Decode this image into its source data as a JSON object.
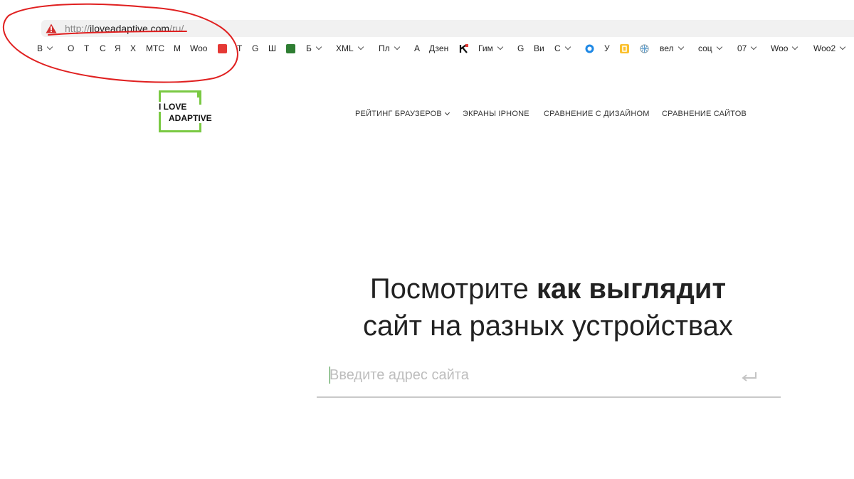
{
  "browser": {
    "url_protocol": "http://",
    "url_host": "iloveadaptive.com",
    "url_path": "/ru/",
    "security_icon": "warning-triangle-icon"
  },
  "bookmarks": [
    {
      "label": "В",
      "dropdown": true
    },
    {
      "label": "О"
    },
    {
      "label": "Т"
    },
    {
      "label": "С"
    },
    {
      "label": "Я"
    },
    {
      "label": "Х"
    },
    {
      "label": "МТС"
    },
    {
      "label": "М"
    },
    {
      "label": "Woo"
    },
    {
      "label": "",
      "icon": "red-square-favicon"
    },
    {
      "label": "Т"
    },
    {
      "label": "G"
    },
    {
      "label": "Ш"
    },
    {
      "label": "",
      "icon": "green-square-favicon"
    },
    {
      "label": "Б",
      "dropdown": true
    },
    {
      "label": "XML",
      "dropdown": true
    },
    {
      "label": "Пл",
      "dropdown": true
    },
    {
      "label": "А"
    },
    {
      "label": "Дзен"
    },
    {
      "label": "",
      "icon": "k-favicon"
    },
    {
      "label": "Гим",
      "dropdown": true
    },
    {
      "label": "G"
    },
    {
      "label": "Ви"
    },
    {
      "label": "С",
      "dropdown": true
    },
    {
      "label": "",
      "icon": "blue-ring-favicon"
    },
    {
      "label": "У"
    },
    {
      "label": "",
      "icon": "yellow-favicon"
    },
    {
      "label": "",
      "icon": "globe-favicon"
    },
    {
      "label": "вел",
      "dropdown": true
    },
    {
      "label": "соц",
      "dropdown": true
    },
    {
      "label": "07",
      "dropdown": true
    },
    {
      "label": "Woo",
      "dropdown": true
    },
    {
      "label": "Woo2",
      "dropdown": true
    }
  ],
  "logo": {
    "line1": "I LOVE",
    "line2": "ADAPTIVE",
    "accent_color": "#7ac943"
  },
  "nav": {
    "items": [
      {
        "label": "РЕЙТИНГ БРАУЗЕРОВ",
        "dropdown": true
      },
      {
        "label": "ЭКРАНЫ IPHONE"
      },
      {
        "label": "СРАВНЕНИЕ С ДИЗАЙНОМ"
      },
      {
        "label": "СРАВНЕНИЕ САЙТОВ"
      }
    ]
  },
  "hero": {
    "line1_normal": "Посмотрите ",
    "line1_bold": "как выглядит",
    "line2": "сайт на разных устройствах"
  },
  "search": {
    "placeholder": "Введите адрес сайта",
    "value": "",
    "submit_icon": "enter-return-icon"
  },
  "annotation": {
    "color": "#e02020"
  }
}
